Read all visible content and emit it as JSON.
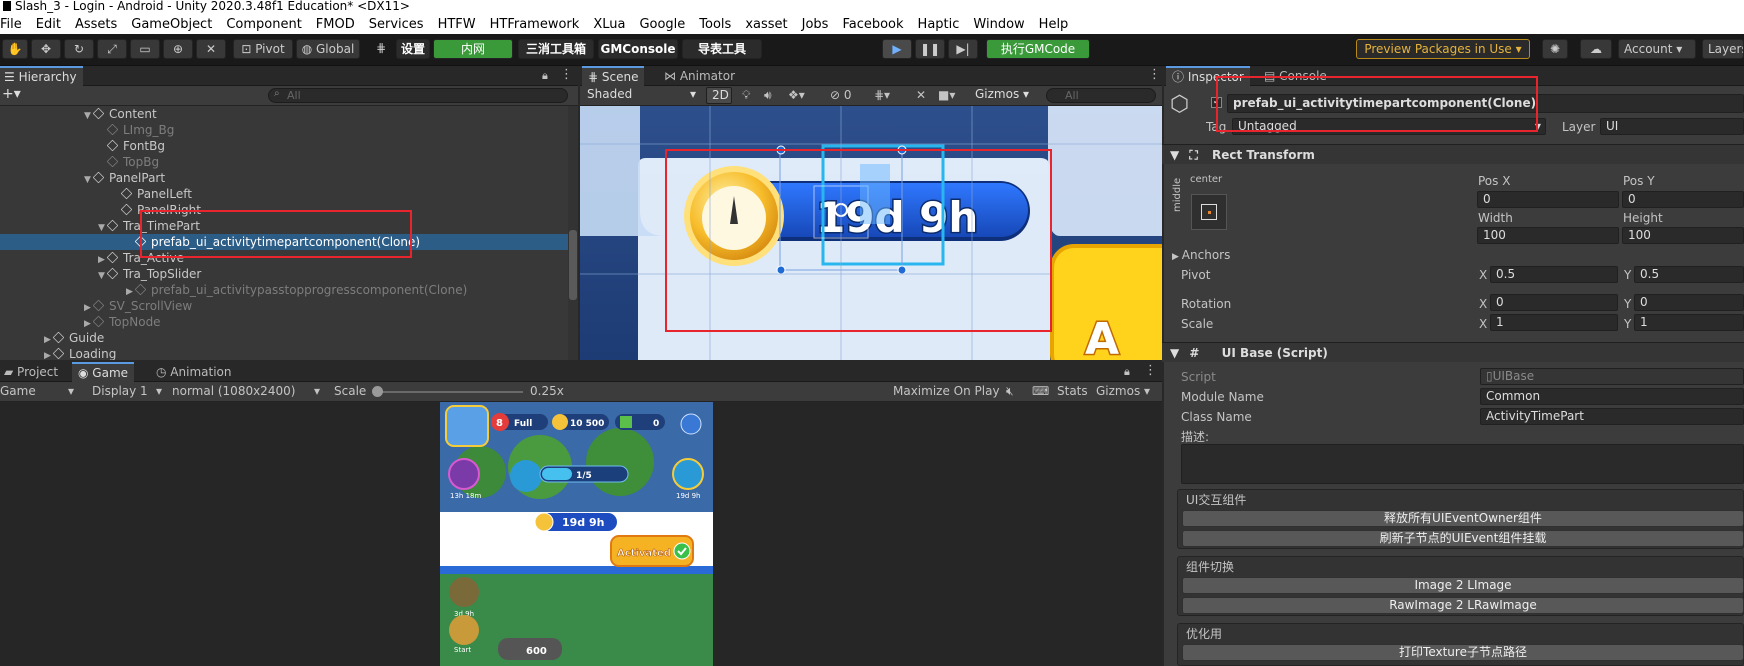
{
  "window": {
    "title": "Slash_3 - Login - Android - Unity 2020.3.48f1 Education* <DX11>"
  },
  "menu": [
    "File",
    "Edit",
    "Assets",
    "GameObject",
    "Component",
    "FMOD",
    "Services",
    "HTFW",
    "HTFramework",
    "XLua",
    "Google",
    "Tools",
    "xasset",
    "Jobs",
    "Facebook",
    "Haptic",
    "Window",
    "Help"
  ],
  "toolbar": {
    "pivot": "Pivot",
    "global": "Global",
    "settings": "设置",
    "intranet": "内网",
    "match3": "三消工具箱",
    "gmconsole": "GMConsole",
    "export": "导表工具",
    "exec_gm": "执行GMCode",
    "preview_packages": "Preview Packages in Use",
    "account": "Account",
    "layers": "Layers"
  },
  "hierarchy": {
    "tab": "Hierarchy",
    "search_placeholder": "All",
    "rows": [
      {
        "label": "Content",
        "indent": 108,
        "arrow": "▼",
        "style": "normal"
      },
      {
        "label": "LImg_Bg",
        "indent": 122,
        "arrow": "",
        "style": "dim"
      },
      {
        "label": "FontBg",
        "indent": 122,
        "arrow": "",
        "style": "normal"
      },
      {
        "label": "TopBg",
        "indent": 122,
        "arrow": "",
        "style": "dim"
      },
      {
        "label": "PanelPart",
        "indent": 108,
        "arrow": "▼",
        "style": "normal"
      },
      {
        "label": "PanelLeft",
        "indent": 136,
        "arrow": "",
        "style": "normal"
      },
      {
        "label": "PanelRight",
        "indent": 136,
        "arrow": "",
        "style": "normal"
      },
      {
        "label": "Tra_TimePart",
        "indent": 122,
        "arrow": "▼",
        "style": "normal"
      },
      {
        "label": "prefab_ui_activitytimepartcomponent(Clone)",
        "indent": 150,
        "arrow": "",
        "style": "sel"
      },
      {
        "label": "Tra_Active",
        "indent": 122,
        "arrow": "▶",
        "style": "normal"
      },
      {
        "label": "Tra_TopSlider",
        "indent": 122,
        "arrow": "▼",
        "style": "normal"
      },
      {
        "label": "prefab_ui_activitypasstopprogresscomponent(Clone)",
        "indent": 150,
        "arrow": "▶",
        "style": "dim"
      },
      {
        "label": "SV_ScrollView",
        "indent": 108,
        "arrow": "▶",
        "style": "dim"
      },
      {
        "label": "TopNode",
        "indent": 108,
        "arrow": "▶",
        "style": "dim"
      },
      {
        "label": "Guide",
        "indent": 68,
        "arrow": "▶",
        "style": "normal"
      },
      {
        "label": "Loading",
        "indent": 68,
        "arrow": "▶",
        "style": "normal"
      }
    ]
  },
  "scene": {
    "tab_scene": "Scene",
    "tab_animator": "Animator",
    "shading": "Shaded",
    "mode2d": "2D",
    "hidden_count": "0",
    "gizmos": "Gizmos",
    "search_placeholder": "All",
    "timer_text": "19d 9h"
  },
  "game": {
    "tab_project": "Project",
    "tab_game": "Game",
    "tab_animation": "Animation",
    "display_mode": "Game",
    "display": "Display 1",
    "resolution": "normal (1080x2400)",
    "scale_label": "Scale",
    "scale_value": "0.25x",
    "maximize": "Maximize On Play",
    "stats": "Stats",
    "gizmos": "Gizmos",
    "hud_lives": "8",
    "hud_full": "Full",
    "hud_coins": "10 500",
    "hud_cash": "0",
    "progress": "1/5",
    "banner_timer": "19d 9h",
    "activated": "Activated",
    "bottom_value": "600",
    "timer_small1": "13h 18m",
    "timer_small2": "19d 9h",
    "timer_small3": "3d 9h",
    "timer_small4": "Start"
  },
  "inspector": {
    "tab_inspector": "Inspector",
    "tab_console": "Console",
    "object_name": "prefab_ui_activitytimepartcomponent(Clone)",
    "tag_label": "Tag",
    "tag_value": "Untagged",
    "layer_label": "Layer",
    "layer_value": "UI",
    "rect_transform": "Rect Transform",
    "anchor_top": "center",
    "anchor_side": "middle",
    "posx_label": "Pos X",
    "posy_label": "Pos Y",
    "posx": "0",
    "posy": "0",
    "width_label": "Width",
    "height_label": "Height",
    "width": "100",
    "height": "100",
    "anchors": "Anchors",
    "pivot_label": "Pivot",
    "pivot_x": "0.5",
    "pivot_y": "0.5",
    "rotation_label": "Rotation",
    "rot_x": "0",
    "rot_y": "0",
    "scale_label": "Scale",
    "scale_x": "1",
    "scale_y": "1",
    "x": "X",
    "y": "Y",
    "uibase": "UI Base (Script)",
    "script_label": "Script",
    "script_value": "UIBase",
    "module_label": "Module Name",
    "module_value": "Common",
    "class_label": "Class Name",
    "class_value": "ActivityTimePart",
    "desc_label": "描述:",
    "group1": "UI交互组件",
    "btn1": "释放所有UIEventOwner组件",
    "btn2": "刷新子节点的UIEvent组件挂载",
    "group2": "组件切换",
    "btn3": "Image 2 LImage",
    "btn4": "RawImage 2 LRawImage",
    "group3": "优化用",
    "btn5": "打印Texture子节点路径"
  }
}
